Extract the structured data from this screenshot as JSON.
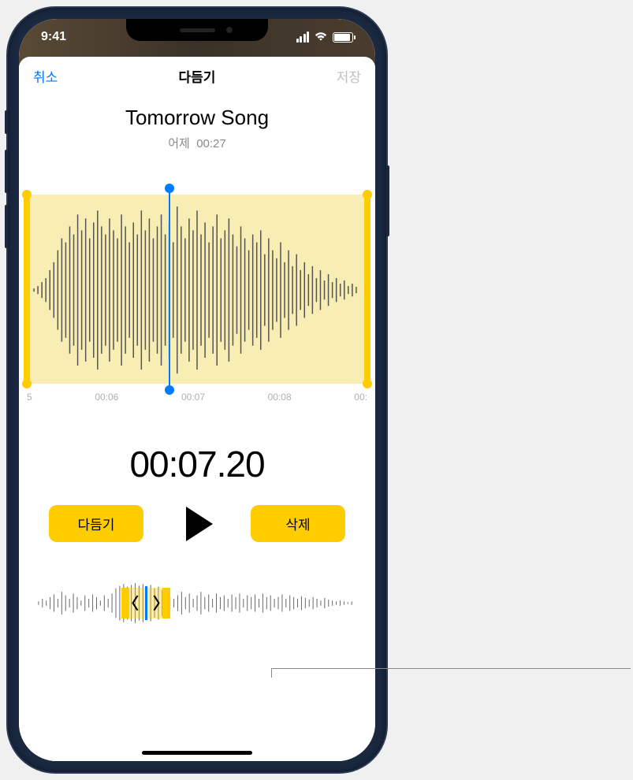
{
  "status": {
    "time": "9:41"
  },
  "nav": {
    "cancel": "취소",
    "title": "다듬기",
    "save": "저장"
  },
  "recording": {
    "title": "Tomorrow Song",
    "date": "어제",
    "duration": "00:27"
  },
  "timeline": {
    "ticks": [
      "5",
      "00:06",
      "00:07",
      "00:08",
      "00:"
    ],
    "playhead_time": "00:07.20"
  },
  "controls": {
    "trim_label": "다듬기",
    "delete_label": "삭제"
  }
}
